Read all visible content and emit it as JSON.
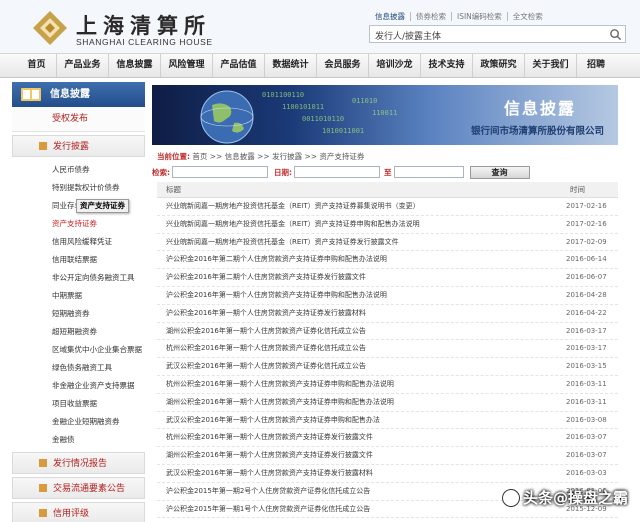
{
  "header": {
    "logo_cn": "上海清算所",
    "logo_en": "SHANGHAI CLEARING HOUSE",
    "top_links": [
      "信息披露",
      "债券检索",
      "ISIN编码检索",
      "全文检索"
    ],
    "search_placeholder": "发行人/披露主体"
  },
  "nav": {
    "items": [
      {
        "label": "首页",
        "w": 40
      },
      {
        "label": "产品业务",
        "w": 52
      },
      {
        "label": "信息披露",
        "w": 52
      },
      {
        "label": "风险管理",
        "w": 52
      },
      {
        "label": "产品估值",
        "w": 52
      },
      {
        "label": "数据统计",
        "w": 52
      },
      {
        "label": "会员服务",
        "w": 52
      },
      {
        "label": "培训沙龙",
        "w": 52
      },
      {
        "label": "技术支持",
        "w": 52
      },
      {
        "label": "政策研究",
        "w": 52
      },
      {
        "label": "关于我们",
        "w": 52
      },
      {
        "label": "招聘",
        "w": 38
      }
    ]
  },
  "sidebar": {
    "title": "信息披露",
    "sub": "受权发布",
    "section1": "发行披露",
    "items": [
      "人民币债券",
      "特别提款权计价债券",
      "同业存单",
      "资产支持证券",
      "信用风险缓释凭证",
      "信用联结票据",
      "非公开定向债务融资工具",
      "中期票据",
      "短期融资券",
      "超短期融资券",
      "区域集优中小企业集合票据",
      "绿色债务融资工具",
      "非金融企业资产支持票据",
      "项目收益票据",
      "金融企业短期融资券",
      "金融债"
    ],
    "tooltip": "资产支持证券",
    "section2": "发行情况报告",
    "section3": "交易流通要素公告",
    "section4": "信用评级"
  },
  "banner": {
    "title": "信息披露",
    "subtitle": "银行间市场清算所股份有限公司"
  },
  "breadcrumb": {
    "label": "当前位置:",
    "path": "首页 >> 信息披露 >> 发行披露 >> 资产支持证券"
  },
  "filter": {
    "search_label": "检索:",
    "date_label": "日期:",
    "to_label": "至",
    "query_button": "查询"
  },
  "table": {
    "col_title": "标题",
    "col_time": "时间",
    "rows": [
      {
        "title": "兴业皖新阅嘉一期房地产投资信托基金（REIT）资产支持证券募集说明书（变更）",
        "date": "2017-02-16"
      },
      {
        "title": "兴业皖新阅嘉一期房地产投资信托基金（REIT）资产支持证券申购和配售办法说明",
        "date": "2017-02-16"
      },
      {
        "title": "兴业皖新阅嘉一期房地产投资信托基金（REIT）资产支持证券发行披露文件",
        "date": "2017-02-09"
      },
      {
        "title": "沪公积金2016年第二期个人住房贷款资产支持证券申购和配售办法说明",
        "date": "2016-06-14"
      },
      {
        "title": "沪公积金2016年第二期个人住房贷款资产支持证券发行披露文件",
        "date": "2016-06-07"
      },
      {
        "title": "沪公积金2016年第一期个人住房贷款资产支持证券申购和配售办法说明",
        "date": "2016-04-28"
      },
      {
        "title": "沪公积金2016年第一期个人住房贷款资产支持证券发行披露材料",
        "date": "2016-04-22"
      },
      {
        "title": "湖州公积金2016年第一期个人住房贷款资产证券化信托成立公告",
        "date": "2016-03-17"
      },
      {
        "title": "杭州公积金2016年第一期个人住房贷款资产证券化信托成立公告",
        "date": "2016-03-17"
      },
      {
        "title": "武汉公积金2016年第一期个人住房贷款资产证券化信托成立公告",
        "date": "2016-03-15"
      },
      {
        "title": "杭州公积金2016年第一期个人住房贷款资产支持证券申购和配售办法说明",
        "date": "2016-03-11"
      },
      {
        "title": "湖州公积金2016年第一期个人住房贷款资产支持证券申购和配售办法说明",
        "date": "2016-03-11"
      },
      {
        "title": "武汉公积金2016年第一期个人住房贷款资产支持证券申购和配售办法",
        "date": "2016-03-08"
      },
      {
        "title": "杭州公积金2016年第一期个人住房贷款资产支持证券发行披露文件",
        "date": "2016-03-07"
      },
      {
        "title": "湖州公积金2016年第一期个人住房贷款资产支持证券发行披露文件",
        "date": "2016-03-07"
      },
      {
        "title": "武汉公积金2016年第一期个人住房贷款资产支持证券发行披露材料",
        "date": "2016-03-03"
      },
      {
        "title": "沪公积金2015年第一期2号个人住房贷款资产证券化信托成立公告",
        "date": "2016-01-06"
      },
      {
        "title": "沪公积金2015年第一期1号个人住房贷款资产证券化信托成立公告",
        "date": "2015-12-09"
      }
    ]
  },
  "watermark": "头条@操盘之霸"
}
